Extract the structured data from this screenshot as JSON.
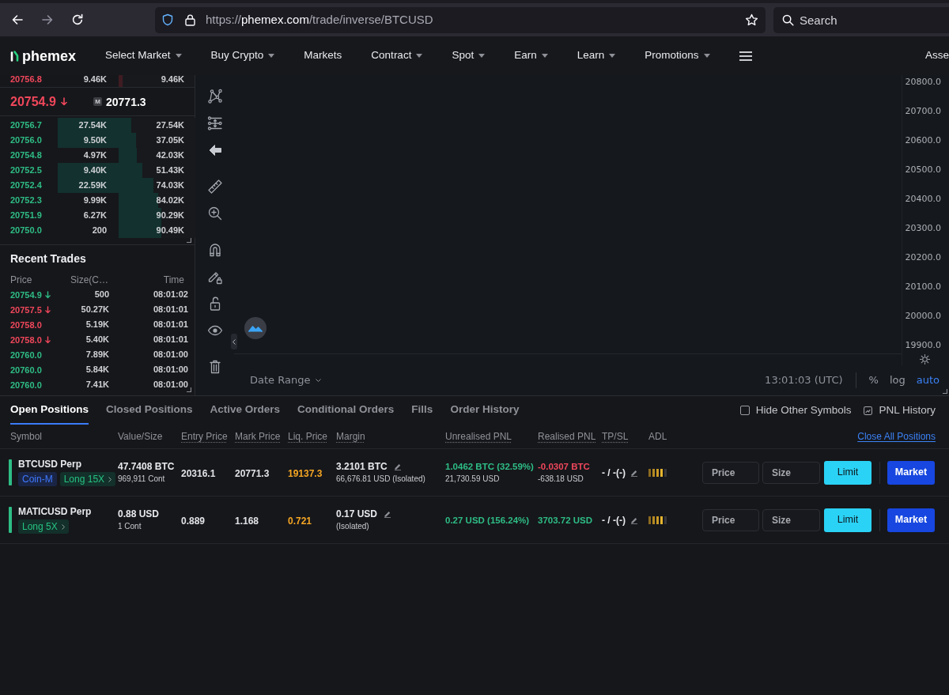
{
  "browser": {
    "nav_buttons": [
      {
        "kind": "back",
        "disabled": false
      },
      {
        "kind": "forward",
        "disabled": true
      },
      {
        "kind": "reload",
        "disabled": false
      }
    ],
    "url": {
      "scheme": "https://",
      "host": "phemex.com",
      "path": "/trade/inverse/BTCUSD"
    },
    "search": {
      "placeholder": "Search"
    }
  },
  "header": {
    "logo": "phemex",
    "menu": [
      {
        "label": "Select Market",
        "dropdown": true
      },
      {
        "label": "Buy Crypto",
        "dropdown": true
      },
      {
        "label": "Markets",
        "dropdown": false
      },
      {
        "label": "Contract",
        "dropdown": true
      },
      {
        "label": "Spot",
        "dropdown": true
      },
      {
        "label": "Earn",
        "dropdown": true
      },
      {
        "label": "Learn",
        "dropdown": true
      },
      {
        "label": "Promotions",
        "dropdown": true
      }
    ],
    "account_link": "Asse"
  },
  "order_book": {
    "asks": [
      {
        "price": "20756.8",
        "size": "9.46K",
        "total": "9.46K",
        "total_bar": {
          "level": 0.05
        }
      }
    ],
    "last_price": {
      "value": "20754.9",
      "color": "#f0475b",
      "arrow": true
    },
    "mark_price": {
      "badge": "M",
      "value": "20771.3"
    },
    "bids": [
      {
        "price": "20756.7",
        "size": "27.54K",
        "total": "27.54K",
        "size_bar": {
          "level": 1
        },
        "total_bar": {
          "level": 0.17
        }
      },
      {
        "price": "20756.0",
        "size": "9.50K",
        "total": "37.05K",
        "size_bar": {
          "level": 1
        },
        "total_bar": {
          "level": 0.23
        }
      },
      {
        "price": "20754.8",
        "size": "4.97K",
        "total": "42.03K",
        "total_bar": {
          "level": 0.24
        }
      },
      {
        "price": "20752.5",
        "size": "9.40K",
        "total": "51.43K",
        "size_bar": {
          "level": 1
        },
        "total_bar": {
          "level": 0.31
        }
      },
      {
        "price": "20752.4",
        "size": "22.59K",
        "total": "74.03K",
        "size_bar": {
          "level": 1
        },
        "total_bar": {
          "level": 0.45
        }
      },
      {
        "price": "20752.3",
        "size": "9.99K",
        "total": "84.02K",
        "total_bar": {
          "level": 0.52
        }
      },
      {
        "price": "20751.9",
        "size": "6.27K",
        "total": "90.29K",
        "total_bar": {
          "level": 0.56
        }
      },
      {
        "price": "20750.0",
        "size": "200",
        "total": "90.49K",
        "total_bar": {
          "level": 0.56
        }
      }
    ]
  },
  "recent_trades": {
    "title": "Recent Trades",
    "columns": [
      "Price",
      "Size(C…",
      "Time"
    ],
    "rows": [
      {
        "price": "20754.9",
        "color": "#2ebd85",
        "arrow": true,
        "size": "500",
        "time": "08:01:02"
      },
      {
        "price": "20757.5",
        "color": "#f0475b",
        "arrow": true,
        "size": "50.27K",
        "time": "08:01:01"
      },
      {
        "price": "20758.0",
        "color": "#f0475b",
        "arrow": false,
        "size": "5.19K",
        "time": "08:01:01"
      },
      {
        "price": "20758.0",
        "color": "#f0475b",
        "arrow": true,
        "size": "5.40K",
        "time": "08:01:01"
      },
      {
        "price": "20760.0",
        "color": "#2ebd85",
        "arrow": false,
        "size": "7.89K",
        "time": "08:01:00"
      },
      {
        "price": "20760.0",
        "color": "#2ebd85",
        "arrow": false,
        "size": "5.84K",
        "time": "08:01:00"
      },
      {
        "price": "20760.0",
        "color": "#2ebd85",
        "arrow": false,
        "size": "7.41K",
        "time": "08:01:00"
      }
    ]
  },
  "chart": {
    "price_axis": [
      "20800.0",
      "20700.0",
      "20600.0",
      "20500.0",
      "20400.0",
      "20300.0",
      "20200.0",
      "20100.0",
      "20000.0",
      "19900.0"
    ],
    "date_range": "Date Range",
    "clock": "13:01:03 (UTC)",
    "scale_options": [
      {
        "label": "%",
        "selected": false
      },
      {
        "label": "log",
        "selected": false
      },
      {
        "label": "auto",
        "selected": true
      }
    ]
  },
  "positions": {
    "tabs": [
      {
        "label": "Open Positions",
        "selected": true
      },
      {
        "label": "Closed Positions",
        "selected": false
      },
      {
        "label": "Active Orders",
        "selected": false
      },
      {
        "label": "Conditional Orders",
        "selected": false
      },
      {
        "label": "Fills",
        "selected": false
      },
      {
        "label": "Order History",
        "selected": false
      }
    ],
    "hide_other_symbols": {
      "label": "Hide Other Symbols",
      "checked": false
    },
    "pnl_history": "PNL History",
    "columns": [
      {
        "label": "Symbol",
        "dotted": false
      },
      {
        "label": "Value/Size",
        "dotted": false
      },
      {
        "label": "Entry Price",
        "dotted": true
      },
      {
        "label": "Mark Price",
        "dotted": true
      },
      {
        "label": "Liq. Price",
        "dotted": true
      },
      {
        "label": "Margin",
        "dotted": true
      },
      {
        "label": "Unrealised PNL",
        "dotted": true
      },
      {
        "label": "Realised PNL",
        "dotted": true
      },
      {
        "label": "TP/SL",
        "dotted": true
      },
      {
        "label": "ADL",
        "dotted": false
      }
    ],
    "close_all": "Close All Positions",
    "rows": [
      {
        "color": "#2ebd85",
        "symbol": "BTCUSD Perp",
        "tags": [
          {
            "kind": "margin_mode",
            "label": "Coin-M"
          },
          {
            "kind": "position",
            "label": "Long 15X"
          }
        ],
        "value": "47.7408 BTC",
        "size": "969,911 Cont",
        "entry_price": "20316.1",
        "mark_price": "20771.3",
        "liq_price": "19137.3",
        "margin": {
          "value": "3.2101 BTC",
          "detail": "66,676.81 USD (Isolated)"
        },
        "unrealised_pnl": {
          "value": "1.0462 BTC (32.59%)",
          "detail": "21,730.59 USD",
          "color": "#2ebd85"
        },
        "realised_pnl": {
          "value": "-0.0307 BTC",
          "detail": "-638.18 USD",
          "color": "#f0475b"
        },
        "tp_sl": "- / -(-)",
        "adl": {
          "level": 0.8
        },
        "price_field": {
          "placeholder": "Price"
        },
        "size_field": {
          "placeholder": "Size"
        },
        "limit_button": "Limit",
        "market_button": "Market"
      },
      {
        "color": "#2ebd85",
        "symbol": "MATICUSD Perp",
        "tags": [
          {
            "kind": "position",
            "label": "Long 5X"
          }
        ],
        "value": "0.88 USD",
        "size": "1 Cont",
        "entry_price": "0.889",
        "mark_price": "1.168",
        "liq_price": "0.721",
        "margin": {
          "value": "0.17 USD",
          "detail": "(Isolated)"
        },
        "unrealised_pnl": {
          "value": "0.27 USD (156.24%)",
          "color": "#2ebd85"
        },
        "realised_pnl": {
          "value": "3703.72 USD",
          "color": "#2ebd85"
        },
        "tp_sl": "- / -(-)",
        "adl": {
          "level": 0.8
        },
        "price_field": {
          "placeholder": "Price"
        },
        "size_field": {
          "placeholder": "Size"
        },
        "limit_button": "Limit",
        "market_button": "Market"
      }
    ]
  }
}
